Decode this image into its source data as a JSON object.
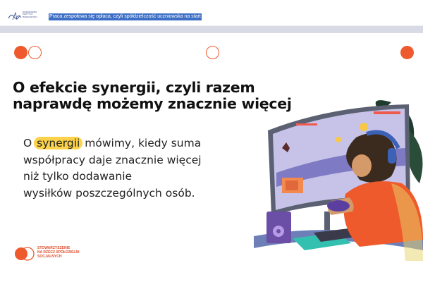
{
  "header": {
    "logo_text": [
      "WARSZAWSKI",
      "INSTYTUT",
      "BANKOWOŚCI"
    ],
    "document_title": "Praca zespołowa się opłaca, czyli spółdzielczość uczniowska na start"
  },
  "slide": {
    "heading_lines": [
      "O efekcie synergii, czyli razem",
      "naprawdę możemy znacznie więcej"
    ],
    "body": {
      "line1_before": "O",
      "highlight": "synergii",
      "line1_after_words": [
        "mówimy,",
        "kiedy",
        "suma"
      ],
      "line2_words": [
        "współpracy",
        "daje",
        "znacznie",
        "więcej"
      ],
      "line3": "niż tylko dodawanie",
      "line4": "wysiłków poszczególnych osób."
    },
    "footer_org": [
      "STOWARZYSZENIE",
      "NA RZECZ SPÓŁDZIELNI",
      "SOCJALNYCH"
    ]
  },
  "colors": {
    "accent_orange": "#ee5a2d",
    "highlight_yellow": "#fbd24a",
    "selection_blue": "#3d6fc6"
  },
  "icons": [
    "wib-logo-icon",
    "decorative-circles-icon",
    "gamer-illustration-icon",
    "organization-logo-icon"
  ]
}
